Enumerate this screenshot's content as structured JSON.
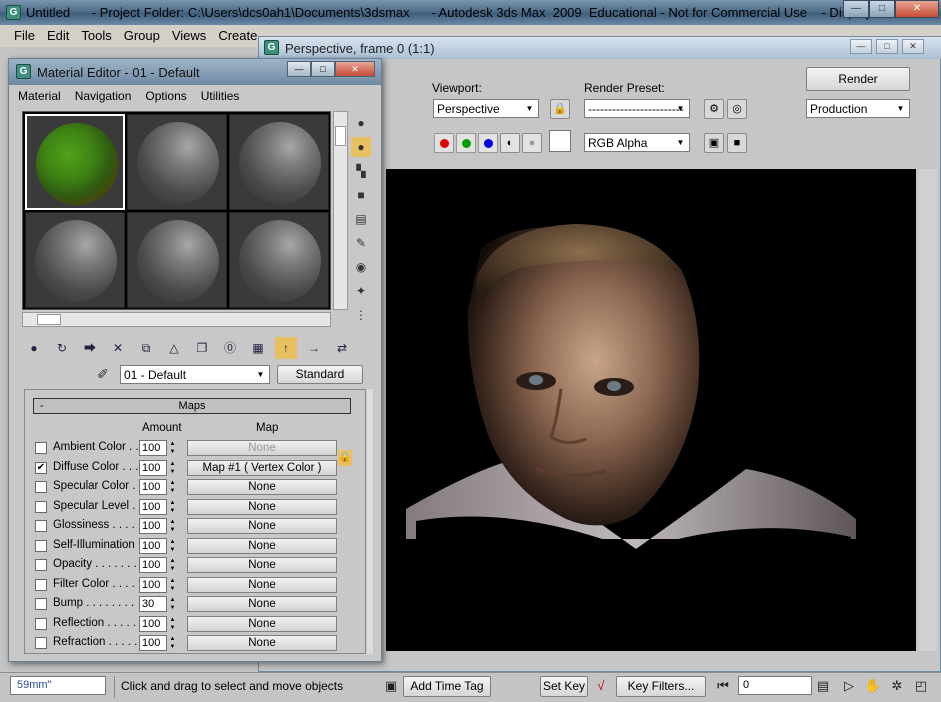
{
  "app": {
    "title": "Untitled      - Project Folder: C:\\Users\\dcs0ah1\\Documents\\3dsmax      - Autodesk 3ds Max  2009  Educational - Not for Commercial Use    - Display : ..."
  },
  "menubar": [
    "File",
    "Edit",
    "Tools",
    "Group",
    "Views",
    "Create"
  ],
  "render_frame": {
    "title": "Perspective, frame 0 (1:1)",
    "viewport_label": "Viewport:",
    "viewport_value": "Perspective",
    "render_preset_label": "Render Preset:",
    "render_preset_value": "------------------------",
    "render_button": "Render",
    "production_value": "Production",
    "channel_value": "RGB Alpha",
    "colors": {
      "red": "#e00000",
      "green": "#00a000",
      "blue": "#0000e0",
      "background": "#000000"
    }
  },
  "material_editor": {
    "title": "Material Editor - 01 - Default",
    "menu": [
      "Material",
      "Navigation",
      "Options",
      "Utilities"
    ],
    "material_name": "01 - Default",
    "material_type": "Standard",
    "maps_rollout": {
      "title": "Maps",
      "minus": "-",
      "col_amount": "Amount",
      "col_map": "Map",
      "rows": [
        {
          "name": "Ambient Color . . .",
          "checked": false,
          "amount": "100",
          "map": "None",
          "dim": true
        },
        {
          "name": "Diffuse Color . . .",
          "checked": true,
          "amount": "100",
          "map": "Map #1  ( Vertex Color )",
          "dim": false
        },
        {
          "name": "Specular Color  . .",
          "checked": false,
          "amount": "100",
          "map": "None",
          "dim": false
        },
        {
          "name": "Specular Level  . .",
          "checked": false,
          "amount": "100",
          "map": "None",
          "dim": false
        },
        {
          "name": "Glossiness  . . . . .",
          "checked": false,
          "amount": "100",
          "map": "None",
          "dim": false
        },
        {
          "name": "Self-Illumination . .",
          "checked": false,
          "amount": "100",
          "map": "None",
          "dim": false
        },
        {
          "name": "Opacity . . . . . . .",
          "checked": false,
          "amount": "100",
          "map": "None",
          "dim": false
        },
        {
          "name": "Filter Color  . . . .",
          "checked": false,
          "amount": "100",
          "map": "None",
          "dim": false
        },
        {
          "name": "Bump  . . . . . . . .",
          "checked": false,
          "amount": "30",
          "map": "None",
          "dim": false
        },
        {
          "name": "Reflection  . . . . .",
          "checked": false,
          "amount": "100",
          "map": "None",
          "dim": false
        },
        {
          "name": "Refraction  . . . . .",
          "checked": false,
          "amount": "100",
          "map": "None",
          "dim": false
        }
      ]
    }
  },
  "status": {
    "coord": "59mm\"",
    "prompt": "Click and drag to select and move objects",
    "add_time_tag": "Add Time Tag",
    "set_key": "Set Key",
    "key_filters": "Key Filters...",
    "frame": "0"
  }
}
